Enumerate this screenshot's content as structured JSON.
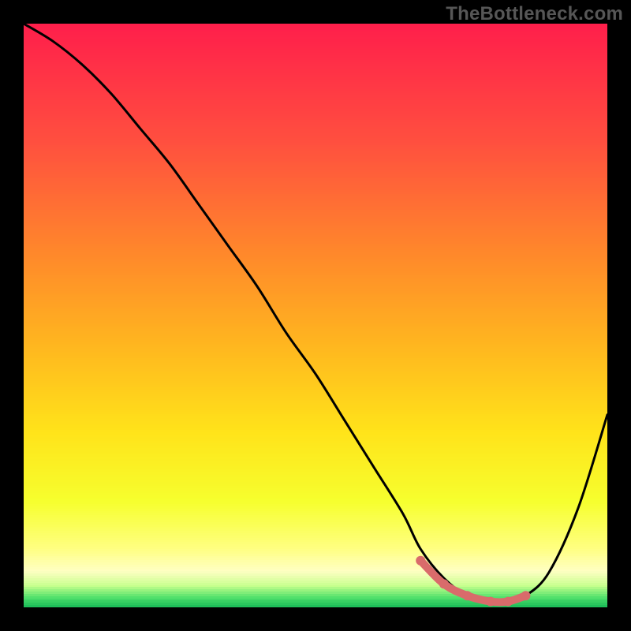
{
  "watermark": "TheBottleneck.com",
  "chart_data": {
    "type": "line",
    "title": "",
    "xlabel": "",
    "ylabel": "",
    "xlim": [
      0,
      100
    ],
    "ylim": [
      0,
      100
    ],
    "series": [
      {
        "name": "bottleneck-curve",
        "x": [
          0,
          5,
          10,
          15,
          20,
          25,
          30,
          35,
          40,
          45,
          50,
          55,
          60,
          65,
          68,
          72,
          76,
          80,
          83,
          86,
          90,
          95,
          100
        ],
        "values": [
          100,
          97,
          93,
          88,
          82,
          76,
          69,
          62,
          55,
          47,
          40,
          32,
          24,
          16,
          10,
          5,
          2,
          1,
          1,
          2,
          6,
          17,
          33
        ]
      },
      {
        "name": "optimal-range-marker",
        "x": [
          68,
          72,
          76,
          80,
          83,
          86
        ],
        "values": [
          8,
          4,
          2,
          1,
          1,
          2
        ]
      }
    ],
    "gradient_stops": [
      {
        "pos": 0.0,
        "color": "#ff1f4b"
      },
      {
        "pos": 0.2,
        "color": "#ff4f3f"
      },
      {
        "pos": 0.4,
        "color": "#ff8a2a"
      },
      {
        "pos": 0.55,
        "color": "#ffb61f"
      },
      {
        "pos": 0.7,
        "color": "#ffe31a"
      },
      {
        "pos": 0.82,
        "color": "#f6ff2e"
      },
      {
        "pos": 0.9,
        "color": "#ffff80"
      },
      {
        "pos": 0.94,
        "color": "#ffffc4"
      },
      {
        "pos": 0.965,
        "color": "#c6ff8d"
      },
      {
        "pos": 0.985,
        "color": "#4fe06b"
      },
      {
        "pos": 1.0,
        "color": "#1fbf5a"
      }
    ],
    "colors": {
      "curve": "#000000",
      "marker": "#d96b6b"
    }
  }
}
